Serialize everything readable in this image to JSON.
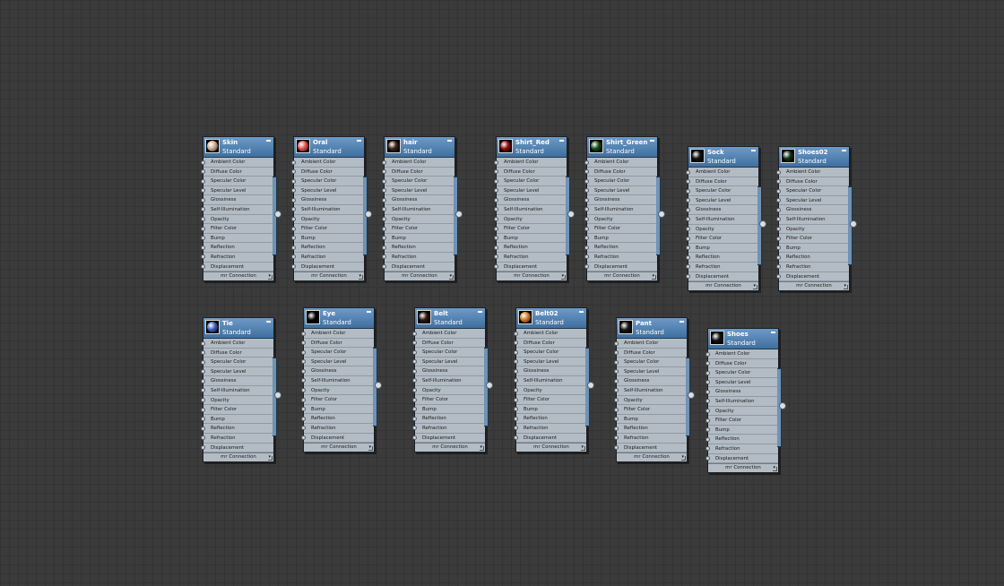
{
  "slot_labels": [
    "Ambient Color",
    "Diffuse Color",
    "Specular Color",
    "Specular Level",
    "Glossiness",
    "Self-Illumination",
    "Opacity",
    "Filter Color",
    "Bump",
    "Reflection",
    "Refraction",
    "Displacement"
  ],
  "footer_label": "mr Connection",
  "nodes": [
    {
      "id": "skin",
      "title": "Skin",
      "subtitle": "Standard",
      "swatch": "#c9a88e"
    },
    {
      "id": "oral",
      "title": "Oral",
      "subtitle": "Standard",
      "swatch": "#e34a4a"
    },
    {
      "id": "hair",
      "title": "hair",
      "subtitle": "Standard",
      "swatch": "#3a2018"
    },
    {
      "id": "shirt-red",
      "title": "Shirt_Red",
      "subtitle": "Standard",
      "swatch": "#8a0a0a"
    },
    {
      "id": "shirt-green",
      "title": "Shirt_Green",
      "subtitle": "Standard",
      "swatch": "#0f4a18"
    },
    {
      "id": "sock",
      "title": "Sock",
      "subtitle": "Standard",
      "swatch": "#111111"
    },
    {
      "id": "shoes02",
      "title": "Shoes02",
      "subtitle": "Standard",
      "swatch": "#0f2a12"
    },
    {
      "id": "tie",
      "title": "Tie",
      "subtitle": "Standard",
      "swatch": "#3b59b8"
    },
    {
      "id": "eye",
      "title": "Eye",
      "subtitle": "Standard",
      "swatch": "#050505"
    },
    {
      "id": "belt",
      "title": "Belt",
      "subtitle": "Standard",
      "swatch": "#2e160f"
    },
    {
      "id": "belt02",
      "title": "Belt02",
      "subtitle": "Standard",
      "swatch": "#d07a20"
    },
    {
      "id": "pant",
      "title": "Pant",
      "subtitle": "Standard",
      "swatch": "#161616"
    },
    {
      "id": "shoes",
      "title": "Shoes",
      "subtitle": "Standard",
      "swatch": "#121212"
    }
  ]
}
